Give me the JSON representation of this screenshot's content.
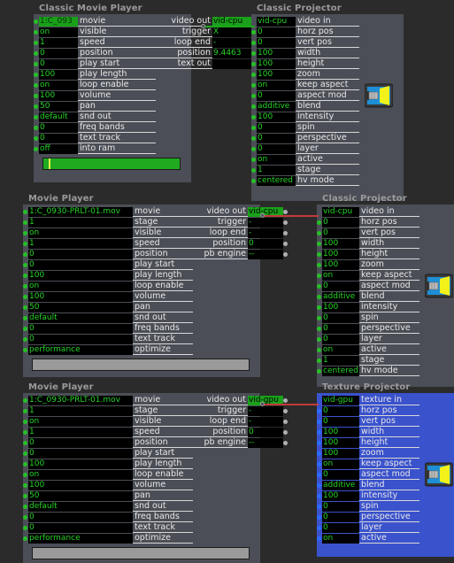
{
  "app": {
    "background": "#2b2b2b",
    "accent_green": "#27d427",
    "accent_blue": "#3a52cc",
    "wire_green": "#1ea81e",
    "wire_red": "#c33a3a"
  },
  "nodes": [
    {
      "id": "classic-movie-player",
      "title": "Classic Movie Player",
      "inputs": [
        {
          "value": "1:C_093",
          "label": "movie",
          "selected": true
        },
        {
          "value": "on",
          "label": "visible"
        },
        {
          "value": "1",
          "label": "speed"
        },
        {
          "value": "0",
          "label": "position"
        },
        {
          "value": "0",
          "label": "play start"
        },
        {
          "value": "100",
          "label": "play length"
        },
        {
          "value": "on",
          "label": "loop enable"
        },
        {
          "value": "100",
          "label": "volume"
        },
        {
          "value": "50",
          "label": "pan"
        },
        {
          "value": "default",
          "label": "snd out"
        },
        {
          "value": "0",
          "label": "freq bands"
        },
        {
          "value": "0",
          "label": "text track"
        },
        {
          "value": "off",
          "label": "into ram"
        }
      ],
      "outputs": [
        {
          "label": "video out",
          "value": "vid-cpu"
        },
        {
          "label": "trigger",
          "value": "X"
        },
        {
          "label": "loop end",
          "value": "-"
        },
        {
          "label": "position",
          "value": "9.4463"
        },
        {
          "label": "text out",
          "value": ""
        }
      ],
      "progress": {
        "percent": 100,
        "playhead_percent": 4
      }
    },
    {
      "id": "classic-projector-top",
      "title": "Classic Projector",
      "inputs": [
        {
          "value": "vid-cpu",
          "label": "video in"
        },
        {
          "value": "0",
          "label": "horz pos"
        },
        {
          "value": "0",
          "label": "vert pos"
        },
        {
          "value": "100",
          "label": "width"
        },
        {
          "value": "100",
          "label": "height"
        },
        {
          "value": "100",
          "label": "zoom"
        },
        {
          "value": "on",
          "label": "keep aspect"
        },
        {
          "value": "0",
          "label": "aspect mod"
        },
        {
          "value": "additive",
          "label": "blend"
        },
        {
          "value": "100",
          "label": "intensity"
        },
        {
          "value": "0",
          "label": "spin"
        },
        {
          "value": "0",
          "label": "perspective"
        },
        {
          "value": "0",
          "label": "layer"
        },
        {
          "value": "on",
          "label": "active"
        },
        {
          "value": "1",
          "label": "stage"
        },
        {
          "value": "centered",
          "label": "hv mode"
        }
      ],
      "icon": "projector-icon"
    },
    {
      "id": "movie-player-mid",
      "title": "Movie Player",
      "inputs": [
        {
          "value": "1:C_0930-PRLT-01.mov",
          "label": "movie"
        },
        {
          "value": "1",
          "label": "stage"
        },
        {
          "value": "on",
          "label": "visible"
        },
        {
          "value": "1",
          "label": "speed"
        },
        {
          "value": "0",
          "label": "position"
        },
        {
          "value": "0",
          "label": "play start"
        },
        {
          "value": "100",
          "label": "play length"
        },
        {
          "value": "on",
          "label": "loop enable"
        },
        {
          "value": "100",
          "label": "volume"
        },
        {
          "value": "50",
          "label": "pan"
        },
        {
          "value": "default",
          "label": "snd out"
        },
        {
          "value": "0",
          "label": "freq bands"
        },
        {
          "value": "0",
          "label": "text track"
        },
        {
          "value": "performance",
          "label": "optimize"
        }
      ],
      "outputs": [
        {
          "label": "video out",
          "value": "vid-cpu"
        },
        {
          "label": "trigger",
          "value": "-"
        },
        {
          "label": "loop end",
          "value": "-"
        },
        {
          "label": "position",
          "value": "0"
        },
        {
          "label": "pb engine",
          "value": "--"
        }
      ],
      "graybar": true
    },
    {
      "id": "classic-projector-mid",
      "title": "Classic Projector",
      "inputs": [
        {
          "value": "vid-cpu",
          "label": "video in"
        },
        {
          "value": "0",
          "label": "horz pos"
        },
        {
          "value": "0",
          "label": "vert pos"
        },
        {
          "value": "100",
          "label": "width"
        },
        {
          "value": "100",
          "label": "height"
        },
        {
          "value": "100",
          "label": "zoom"
        },
        {
          "value": "on",
          "label": "keep aspect"
        },
        {
          "value": "0",
          "label": "aspect mod"
        },
        {
          "value": "additive",
          "label": "blend"
        },
        {
          "value": "100",
          "label": "intensity"
        },
        {
          "value": "0",
          "label": "spin"
        },
        {
          "value": "0",
          "label": "perspective"
        },
        {
          "value": "0",
          "label": "layer"
        },
        {
          "value": "on",
          "label": "active"
        },
        {
          "value": "1",
          "label": "stage"
        },
        {
          "value": "centered",
          "label": "hv mode"
        }
      ],
      "icon": "projector-icon"
    },
    {
      "id": "movie-player-bottom",
      "title": "Movie Player",
      "inputs": [
        {
          "value": "1:C_0930-PRLT-01.mov",
          "label": "movie"
        },
        {
          "value": "1",
          "label": "stage"
        },
        {
          "value": "on",
          "label": "visible"
        },
        {
          "value": "1",
          "label": "speed"
        },
        {
          "value": "0",
          "label": "position"
        },
        {
          "value": "0",
          "label": "play start"
        },
        {
          "value": "100",
          "label": "play length"
        },
        {
          "value": "on",
          "label": "loop enable"
        },
        {
          "value": "100",
          "label": "volume"
        },
        {
          "value": "50",
          "label": "pan"
        },
        {
          "value": "default",
          "label": "snd out"
        },
        {
          "value": "0",
          "label": "freq bands"
        },
        {
          "value": "0",
          "label": "text track"
        },
        {
          "value": "performance",
          "label": "optimize"
        }
      ],
      "outputs": [
        {
          "label": "video out",
          "value": "vid-gpu"
        },
        {
          "label": "trigger",
          "value": "-"
        },
        {
          "label": "loop end",
          "value": "-"
        },
        {
          "label": "position",
          "value": "0"
        },
        {
          "label": "pb engine",
          "value": "--"
        }
      ],
      "graybar": true
    },
    {
      "id": "texture-projector",
      "title": "Texture Projector",
      "inputs": [
        {
          "value": "vid-gpu",
          "label": "texture in"
        },
        {
          "value": "0",
          "label": "horz pos"
        },
        {
          "value": "0",
          "label": "vert pos"
        },
        {
          "value": "100",
          "label": "width"
        },
        {
          "value": "100",
          "label": "height"
        },
        {
          "value": "100",
          "label": "zoom"
        },
        {
          "value": "on",
          "label": "keep aspect"
        },
        {
          "value": "0",
          "label": "aspect mod"
        },
        {
          "value": "additive",
          "label": "blend"
        },
        {
          "value": "100",
          "label": "intensity"
        },
        {
          "value": "0",
          "label": "spin"
        },
        {
          "value": "0",
          "label": "perspective"
        },
        {
          "value": "0",
          "label": "layer"
        },
        {
          "value": "on",
          "label": "active"
        }
      ],
      "icon": "projector-icon"
    }
  ],
  "wires": [
    {
      "name": "wire-cmp-to-projector",
      "color": "green"
    },
    {
      "name": "wire-mp-to-projector",
      "color": "red"
    },
    {
      "name": "wire-mpgpu-to-texture",
      "color": "red"
    }
  ]
}
